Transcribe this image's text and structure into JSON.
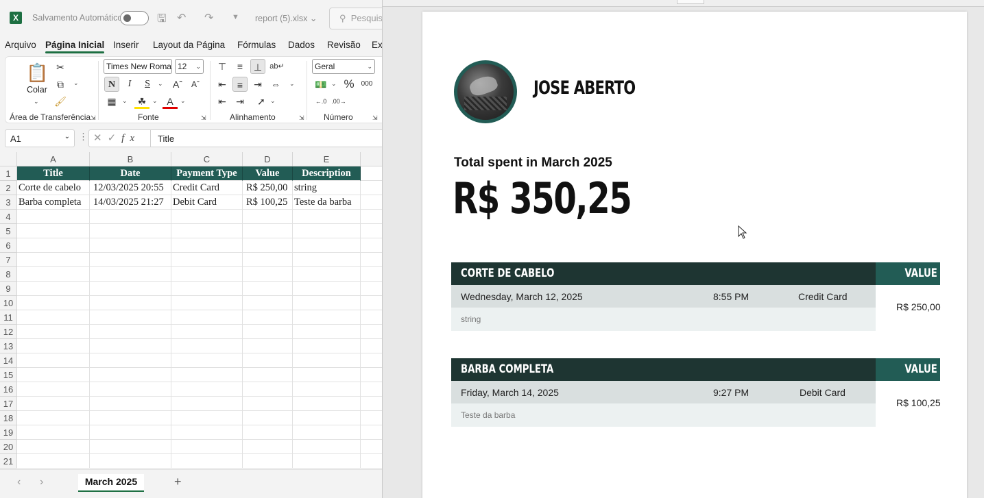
{
  "excel": {
    "autosave_label": "Salvamento Automático",
    "filename": "report (5).xlsx",
    "search_placeholder": "Pesquisar",
    "menu": [
      "Arquivo",
      "Página Inicial",
      "Inserir",
      "Layout da Página",
      "Fórmulas",
      "Dados",
      "Revisão",
      "Ex"
    ],
    "ribbon": {
      "paste_label": "Colar",
      "clipboard_group": "Área de Transferência",
      "font_group": "Fonte",
      "alignment_group": "Alinhamento",
      "number_group": "Número",
      "font_name": "Times New Roman",
      "font_size": "12",
      "number_format": "Geral",
      "bold_label": "N",
      "italic_label": "I",
      "underline_label": "S"
    },
    "name_box": "A1",
    "formula": "Title",
    "columns": [
      "A",
      "B",
      "C",
      "D",
      "E"
    ],
    "rows": [
      "1",
      "2",
      "3",
      "4",
      "5",
      "6",
      "7",
      "8",
      "9",
      "10",
      "11",
      "12",
      "13",
      "14",
      "15",
      "16",
      "17",
      "18",
      "19",
      "20",
      "21"
    ],
    "headers": [
      "Title",
      "Date",
      "Payment Type",
      "Value",
      "Description"
    ],
    "data": [
      [
        "Corte de cabelo",
        "12/03/2025 20:55",
        "Credit Card",
        "R$ 250,00",
        "string"
      ],
      [
        "Barba completa",
        "14/03/2025 21:27",
        "Debit Card",
        "R$ 100,25",
        "Teste da barba"
      ]
    ],
    "sheet_tab": "March 2025",
    "accent_color": "#1d6f42",
    "header_fill": "#225c55"
  },
  "report": {
    "name": "JOSE ABERTO",
    "total_label": "Total spent in March 2025",
    "total_value": "R$ 350,25",
    "entries": [
      {
        "title": "CORTE DE CABELO",
        "value_header": "VALUE",
        "date": "Wednesday, March 12, 2025",
        "time": "8:55 PM",
        "payment": "Credit Card",
        "description": "string",
        "value": "R$ 250,00"
      },
      {
        "title": "BARBA COMPLETA",
        "value_header": "VALUE",
        "date": "Friday, March 14, 2025",
        "time": "9:27 PM",
        "payment": "Debit Card",
        "description": "Teste da barba",
        "value": "R$ 100,25"
      }
    ],
    "dark_color": "#1e3532",
    "teal_color": "#225c55"
  }
}
